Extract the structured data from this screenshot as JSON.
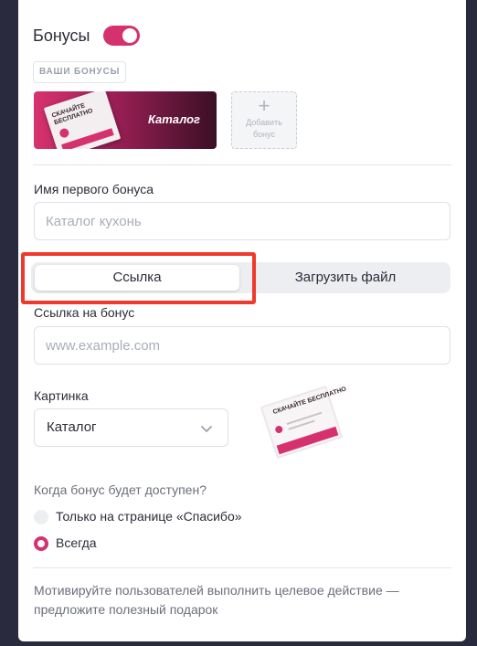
{
  "header": {
    "title": "Бонусы",
    "toggle_on": true
  },
  "bonuses": {
    "badge": "ВАШИ БОНУСЫ",
    "card": {
      "label": "Каталог",
      "paper_text": "СКАЧАЙТЕ БЕСПЛАТНО"
    },
    "add": {
      "plus": "+",
      "line1": "Добавить",
      "line2": "бонус"
    }
  },
  "name_field": {
    "label": "Имя первого бонуса",
    "placeholder": "Каталог кухонь",
    "value": ""
  },
  "tabs": {
    "link": "Ссылка",
    "upload": "Загрузить файл",
    "active": "link"
  },
  "link_field": {
    "label": "Ссылка на бонус",
    "placeholder": "www.example.com",
    "value": ""
  },
  "picture": {
    "label": "Картинка",
    "selected": "Каталог",
    "preview_text": "СКАЧАЙТЕ БЕСПЛАТНО"
  },
  "availability": {
    "question": "Когда бонус будет доступен?",
    "options": [
      {
        "label": "Только на странице «Спасибо»",
        "checked": false
      },
      {
        "label": "Всегда",
        "checked": true
      }
    ]
  },
  "hint": "Мотивируйте пользователей выполнить целевое действие — предложите полезный подарок",
  "colors": {
    "accent": "#d6316f",
    "highlight": "#f0392b"
  }
}
